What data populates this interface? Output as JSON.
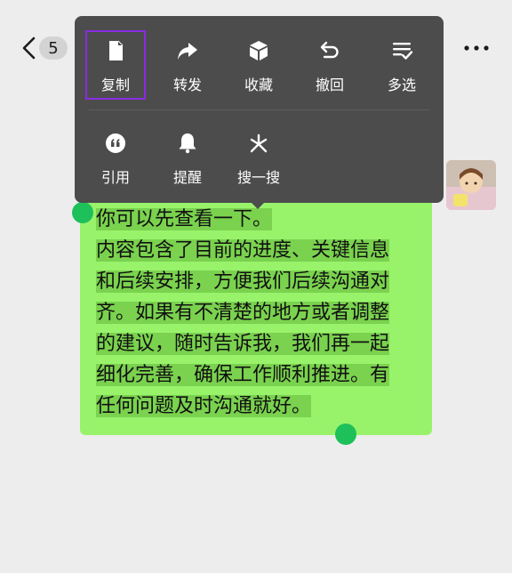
{
  "header": {
    "unread_count": "5"
  },
  "menu": {
    "row1": [
      {
        "label": "复制",
        "icon": "copy-icon"
      },
      {
        "label": "转发",
        "icon": "forward-icon"
      },
      {
        "label": "收藏",
        "icon": "favorite-icon"
      },
      {
        "label": "撤回",
        "icon": "recall-icon"
      },
      {
        "label": "多选",
        "icon": "multi-select-icon"
      }
    ],
    "row2": [
      {
        "label": "引用",
        "icon": "quote-icon"
      },
      {
        "label": "提醒",
        "icon": "bell-icon"
      },
      {
        "label": "搜一搜",
        "icon": "search-sparkle-icon"
      }
    ],
    "highlight_color": "#8a2be2"
  },
  "message": {
    "lines": [
      "你可以先查看一下。",
      "内容包含了目前的进度、关键信息",
      "和后续安排，方便我们后续沟通对",
      "齐。如果有不清楚的地方或者调整",
      "的建议，随时告诉我，我们再一起",
      "细化完善，确保工作顺利推进。有",
      "任何问题及时沟通就好。"
    ],
    "bubble_color": "#98f36b",
    "selection_color": "#7ad24e",
    "handle_color": "#1ec05a"
  }
}
